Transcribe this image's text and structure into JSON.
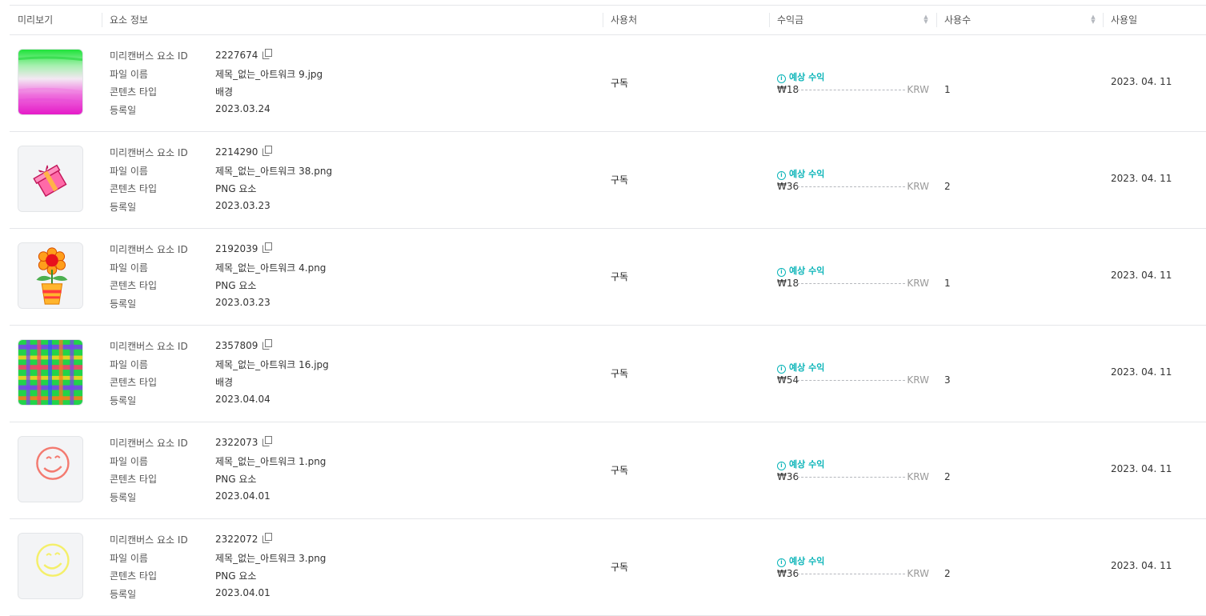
{
  "header": {
    "preview": "미리보기",
    "info": "요소 정보",
    "usage": "사용처",
    "revenue": "수익금",
    "count": "사용수",
    "date": "사용일"
  },
  "labels": {
    "id": "미리캔버스 요소 ID",
    "filename": "파일 이름",
    "type": "콘텐츠 타입",
    "registered": "등록일",
    "expected": "예상 수익",
    "currency": "KRW"
  },
  "rows": [
    {
      "thumb": "pink-green-gradient",
      "id": "2227674",
      "filename": "제목_없는_아트워크 9.jpg",
      "type": "배경",
      "registered": "2023.03.24",
      "usage": "구독",
      "amount": "₩18",
      "count": "1",
      "date": "2023. 04. 11"
    },
    {
      "thumb": "gift-box",
      "id": "2214290",
      "filename": "제목_없는_아트워크 38.png",
      "type": "PNG 요소",
      "registered": "2023.03.23",
      "usage": "구독",
      "amount": "₩36",
      "count": "2",
      "date": "2023. 04. 11"
    },
    {
      "thumb": "flower-pot",
      "id": "2192039",
      "filename": "제목_없는_아트워크 4.png",
      "type": "PNG 요소",
      "registered": "2023.03.23",
      "usage": "구독",
      "amount": "₩18",
      "count": "1",
      "date": "2023. 04. 11"
    },
    {
      "thumb": "plaid-pattern",
      "id": "2357809",
      "filename": "제목_없는_아트워크 16.jpg",
      "type": "배경",
      "registered": "2023.04.04",
      "usage": "구독",
      "amount": "₩54",
      "count": "3",
      "date": "2023. 04. 11"
    },
    {
      "thumb": "smiley-red",
      "id": "2322073",
      "filename": "제목_없는_아트워크 1.png",
      "type": "PNG 요소",
      "registered": "2023.04.01",
      "usage": "구독",
      "amount": "₩36",
      "count": "2",
      "date": "2023. 04. 11"
    },
    {
      "thumb": "smiley-yellow",
      "id": "2322072",
      "filename": "제목_없는_아트워크 3.png",
      "type": "PNG 요소",
      "registered": "2023.04.01",
      "usage": "구독",
      "amount": "₩36",
      "count": "2",
      "date": "2023. 04. 11"
    }
  ],
  "colors": {
    "accent": "#0ab4b8",
    "border": "#e4e6e9"
  }
}
